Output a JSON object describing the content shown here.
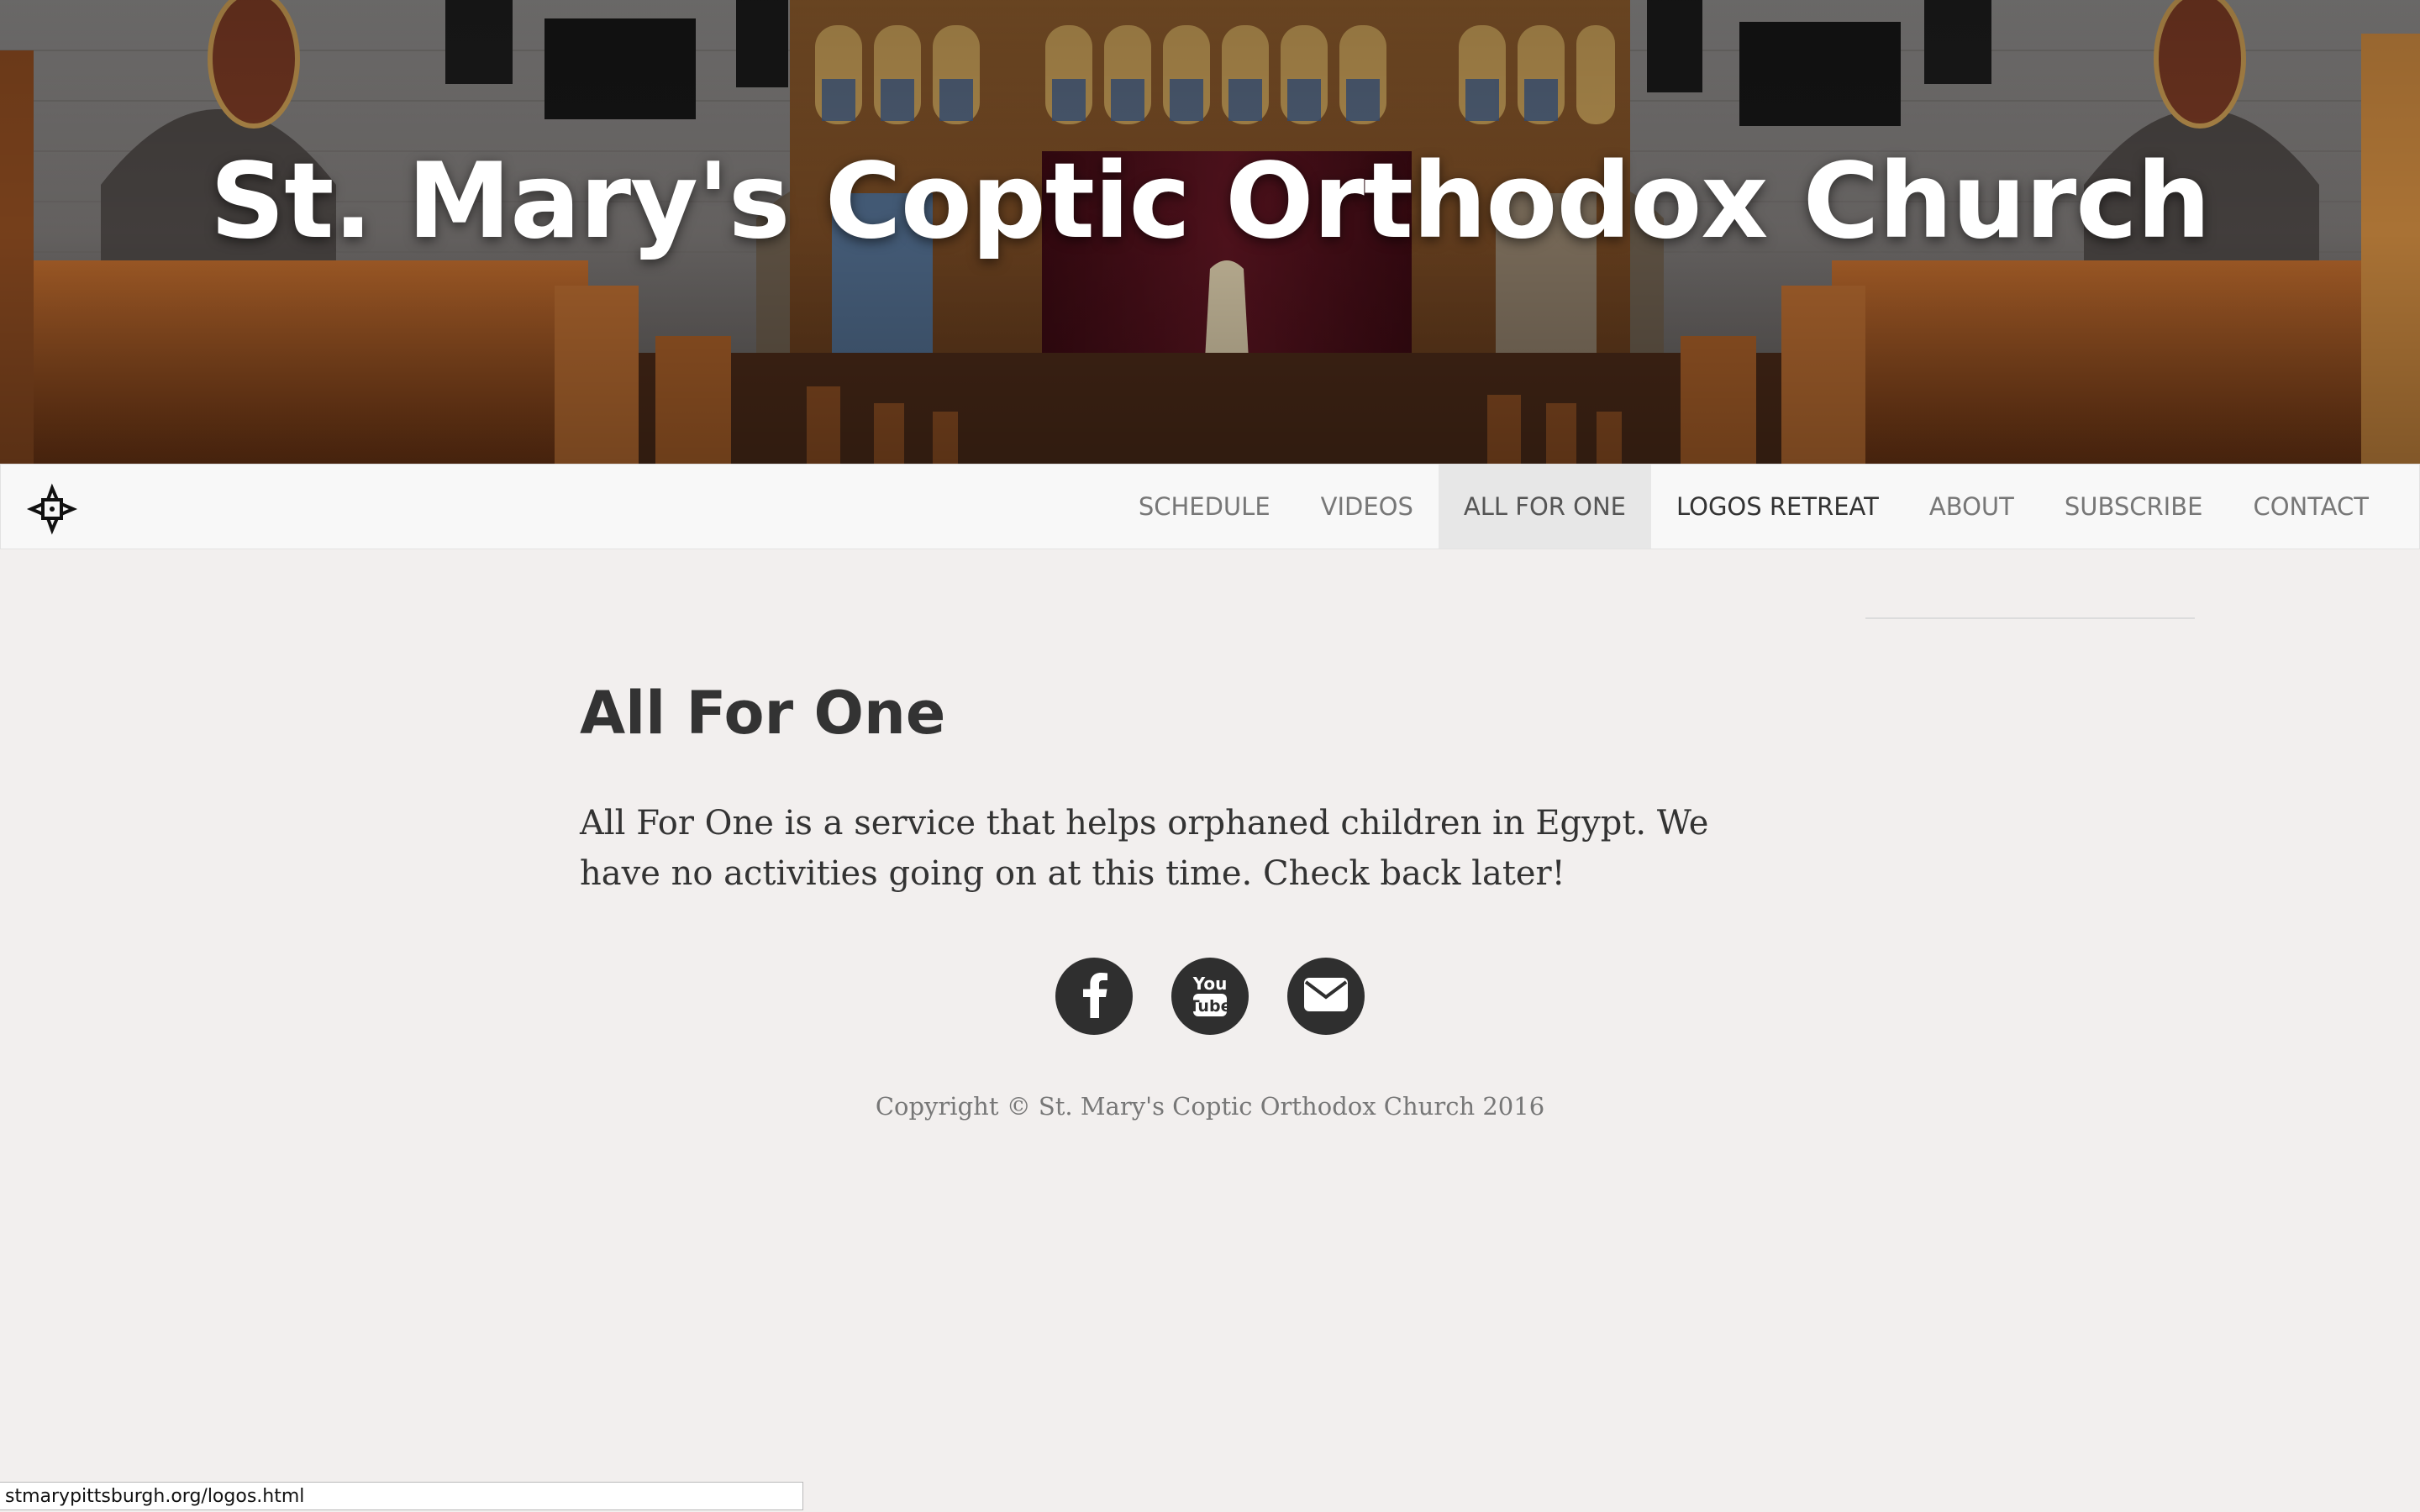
{
  "hero": {
    "title": "St. Mary's Coptic Orthodox Church"
  },
  "navbar": {
    "logo_icon": "coptic-cross-icon",
    "items": [
      {
        "label": "SCHEDULE",
        "state": "default"
      },
      {
        "label": "VIDEOS",
        "state": "default"
      },
      {
        "label": "ALL FOR ONE",
        "state": "active"
      },
      {
        "label": "LOGOS RETREAT",
        "state": "hover"
      },
      {
        "label": "ABOUT",
        "state": "default"
      },
      {
        "label": "SUBSCRIBE",
        "state": "default"
      },
      {
        "label": "CONTACT",
        "state": "default"
      }
    ]
  },
  "content": {
    "title": "All For One",
    "body": "All For One is a service that helps orphaned children in Egypt. We have no activities going on at this time. Check back later!"
  },
  "social": [
    {
      "icon": "facebook-icon"
    },
    {
      "icon": "youtube-icon"
    },
    {
      "icon": "envelope-icon"
    }
  ],
  "footer": {
    "copyright": "Copyright © St. Mary's Coptic Orthodox Church 2016"
  },
  "status_bar": {
    "url": "stmarypittsburgh.org/logos.html"
  },
  "colors": {
    "page_background": "#f2efee",
    "navbar_background": "#f8f8f8",
    "active_nav_background": "#e7e7e7",
    "social_button": "#2f2f2f",
    "heading_text": "#333333",
    "muted_text": "#777777"
  }
}
